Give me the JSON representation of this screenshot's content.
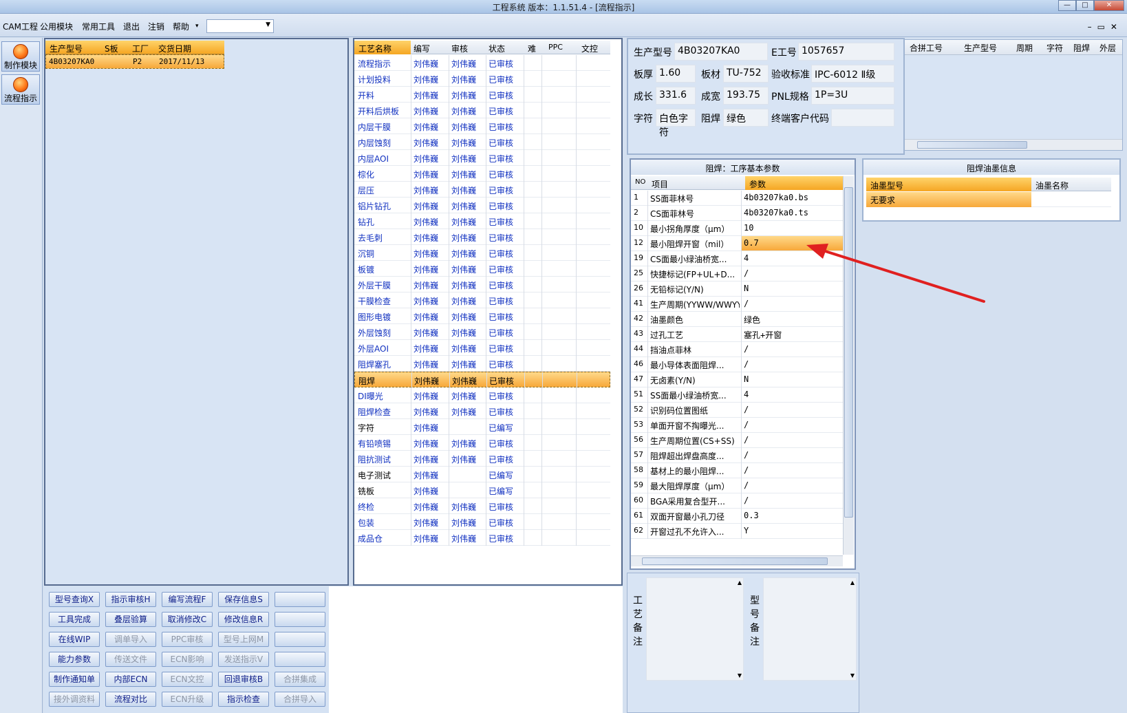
{
  "window": {
    "title": "工程系统   版本：1.1.51.4 - [流程指示]",
    "controls": [
      "—",
      "□",
      "✕"
    ]
  },
  "menu": {
    "items": [
      "CAM工程",
      "公用模块",
      "常用工具",
      "退出",
      "注销",
      "帮助"
    ],
    "help_arrow": "▾",
    "combo_value": "",
    "mdi_controls": "–▭✕"
  },
  "toolbar": {
    "make_module": "制作模块",
    "flow_indication": "流程指示"
  },
  "order_grid": {
    "headers": [
      "生产型号",
      "S板",
      "工厂",
      "交货日期"
    ],
    "rows": [
      [
        "4B03207KA0",
        "",
        "P2",
        "2017/11/13"
      ]
    ]
  },
  "process_grid": {
    "headers": [
      "工艺名称",
      "编写",
      "审核",
      "状态",
      "难",
      "PPC",
      "文控"
    ],
    "selected_index": 20,
    "rows": [
      [
        "流程指示",
        "刘伟巍",
        "刘伟巍",
        "已审核"
      ],
      [
        "计划投料",
        "刘伟巍",
        "刘伟巍",
        "已审核"
      ],
      [
        "开料",
        "刘伟巍",
        "刘伟巍",
        "已审核"
      ],
      [
        "开料后烘板",
        "刘伟巍",
        "刘伟巍",
        "已审核"
      ],
      [
        "内层干膜",
        "刘伟巍",
        "刘伟巍",
        "已审核"
      ],
      [
        "内层蚀刻",
        "刘伟巍",
        "刘伟巍",
        "已审核"
      ],
      [
        "内层AOI",
        "刘伟巍",
        "刘伟巍",
        "已审核"
      ],
      [
        "棕化",
        "刘伟巍",
        "刘伟巍",
        "已审核"
      ],
      [
        "层压",
        "刘伟巍",
        "刘伟巍",
        "已审核"
      ],
      [
        "铝片钻孔",
        "刘伟巍",
        "刘伟巍",
        "已审核"
      ],
      [
        "钻孔",
        "刘伟巍",
        "刘伟巍",
        "已审核"
      ],
      [
        "去毛刺",
        "刘伟巍",
        "刘伟巍",
        "已审核"
      ],
      [
        "沉铜",
        "刘伟巍",
        "刘伟巍",
        "已审核"
      ],
      [
        "板镀",
        "刘伟巍",
        "刘伟巍",
        "已审核"
      ],
      [
        "外层干膜",
        "刘伟巍",
        "刘伟巍",
        "已审核"
      ],
      [
        "干膜检查",
        "刘伟巍",
        "刘伟巍",
        "已审核"
      ],
      [
        "图形电镀",
        "刘伟巍",
        "刘伟巍",
        "已审核"
      ],
      [
        "外层蚀刻",
        "刘伟巍",
        "刘伟巍",
        "已审核"
      ],
      [
        "外层AOI",
        "刘伟巍",
        "刘伟巍",
        "已审核"
      ],
      [
        "阻焊塞孔",
        "刘伟巍",
        "刘伟巍",
        "已审核"
      ],
      [
        "阻焊",
        "刘伟巍",
        "刘伟巍",
        "已审核"
      ],
      [
        "DI曝光",
        "刘伟巍",
        "刘伟巍",
        "已审核"
      ],
      [
        "阻焊检查",
        "刘伟巍",
        "刘伟巍",
        "已审核"
      ],
      [
        "字符",
        "刘伟巍",
        "",
        "已编写"
      ],
      [
        "有铅喷锡",
        "刘伟巍",
        "刘伟巍",
        "已审核"
      ],
      [
        "阻抗测试",
        "刘伟巍",
        "刘伟巍",
        "已审核"
      ],
      [
        "电子测试",
        "刘伟巍",
        "",
        "已编写"
      ],
      [
        "铣板",
        "刘伟巍",
        "",
        "已编写"
      ],
      [
        "终检",
        "刘伟巍",
        "刘伟巍",
        "已审核"
      ],
      [
        "包装",
        "刘伟巍",
        "刘伟巍",
        "已审核"
      ],
      [
        "成品仓",
        "刘伟巍",
        "刘伟巍",
        "已审核"
      ]
    ],
    "black_rows": [
      23,
      26,
      27
    ]
  },
  "buttons": [
    [
      {
        "label": "型号查询X",
        "enabled": true
      },
      {
        "label": "指示审核H",
        "enabled": true
      },
      {
        "label": "编写流程F",
        "enabled": true
      },
      {
        "label": "保存信息S",
        "enabled": true
      },
      {
        "label": "",
        "enabled": true
      }
    ],
    [
      {
        "label": "工具完成",
        "enabled": true
      },
      {
        "label": "叠层验算",
        "enabled": true
      },
      {
        "label": "取消修改C",
        "enabled": true
      },
      {
        "label": "修改信息R",
        "enabled": true
      },
      {
        "label": "",
        "enabled": true
      }
    ],
    [
      {
        "label": "在线WIP",
        "enabled": true
      },
      {
        "label": "调单导入",
        "enabled": false
      },
      {
        "label": "PPC审核",
        "enabled": false
      },
      {
        "label": "型号上网M",
        "enabled": false
      },
      {
        "label": "",
        "enabled": true
      }
    ],
    [
      {
        "label": "能力参数",
        "enabled": true
      },
      {
        "label": "传送文件",
        "enabled": false
      },
      {
        "label": "ECN影响",
        "enabled": false
      },
      {
        "label": "发送指示V",
        "enabled": false
      },
      {
        "label": "",
        "enabled": true
      }
    ],
    [
      {
        "label": "制作通知单",
        "enabled": true
      },
      {
        "label": "内部ECN",
        "enabled": true
      },
      {
        "label": "ECN文控",
        "enabled": false
      },
      {
        "label": "回退审核B",
        "enabled": true
      },
      {
        "label": "合拼集成",
        "enabled": false
      }
    ],
    [
      {
        "label": "接外调资料",
        "enabled": false
      },
      {
        "label": "流程对比",
        "enabled": true
      },
      {
        "label": "ECN升级",
        "enabled": false
      },
      {
        "label": "指示检查",
        "enabled": true
      },
      {
        "label": "合拼导入",
        "enabled": false
      }
    ]
  ],
  "info": {
    "prod_model_label": "生产型号",
    "prod_model": "4B03207KA0",
    "e_no_label": "E工号",
    "e_no": "1057657",
    "thickness_label": "板厚",
    "thickness": "1.60",
    "material_label": "板材",
    "material": "TU-752",
    "standard_label": "验收标准",
    "standard": "IPC-6012 Ⅱ级",
    "length_label": "成长",
    "length": "331.6",
    "width_label": "成宽",
    "width": "193.75",
    "pnl_label": "PNL规格",
    "pnl": "1P=3U",
    "char_label": "字符",
    "char": "白色字符",
    "mask_label": "阻焊",
    "mask": "绿色",
    "customer_label": "终端客户代码",
    "customer": ""
  },
  "merge_grid": {
    "headers": [
      "合拼工号",
      "生产型号",
      "周期",
      "字符",
      "阻焊",
      "外层"
    ]
  },
  "params": {
    "title": "阻焊：工序基本参数",
    "headers": [
      "NO",
      "项目",
      "参数"
    ],
    "selected_index": 3,
    "rows": [
      [
        "1",
        "SS面菲林号",
        "4b03207ka0.bs"
      ],
      [
        "2",
        "CS面菲林号",
        "4b03207ka0.ts"
      ],
      [
        "10",
        "最小拐角厚度（μm）",
        "10"
      ],
      [
        "12",
        "最小阻焊开窗（mil）",
        "0.7"
      ],
      [
        "19",
        "CS面最小绿油桥宽...",
        "4"
      ],
      [
        "25",
        "快捷标记(FP+UL+D...",
        "/"
      ],
      [
        "26",
        "无铅标记(Y/N)",
        "N"
      ],
      [
        "41",
        "生产周期(YYWW/WWYY)",
        "/"
      ],
      [
        "42",
        "油墨颜色",
        "绿色"
      ],
      [
        "43",
        "过孔工艺",
        "塞孔+开窗"
      ],
      [
        "44",
        "挡油点菲林",
        "/"
      ],
      [
        "46",
        "最小导体表面阻焊...",
        "/"
      ],
      [
        "47",
        "无卤素(Y/N)",
        "N"
      ],
      [
        "51",
        "SS面最小绿油桥宽...",
        "4"
      ],
      [
        "52",
        "识别码位置图纸",
        "/"
      ],
      [
        "53",
        "单面开窗不掏曝光...",
        "/"
      ],
      [
        "56",
        "生产周期位置(CS+SS)",
        "/"
      ],
      [
        "57",
        "阻焊超出焊盘高度...",
        "/"
      ],
      [
        "58",
        "基材上的最小阻焊...",
        "/"
      ],
      [
        "59",
        "最大阻焊厚度（μm）",
        "/"
      ],
      [
        "60",
        "BGA采用复合型开...",
        "/"
      ],
      [
        "61",
        "双面开窗最小孔刀径",
        "0.3"
      ],
      [
        "62",
        "开窗过孔不允许入...",
        "Y"
      ]
    ]
  },
  "ink": {
    "title": "阻焊油墨信息",
    "headers": [
      "油墨型号",
      "油墨名称"
    ],
    "rows": [
      [
        "无要求",
        ""
      ]
    ]
  },
  "notes": {
    "process_label": "工艺备注",
    "model_label": "型号备注"
  },
  "colors": {
    "annotation_arrow": "#e02020",
    "selection": "#f7a83a"
  }
}
